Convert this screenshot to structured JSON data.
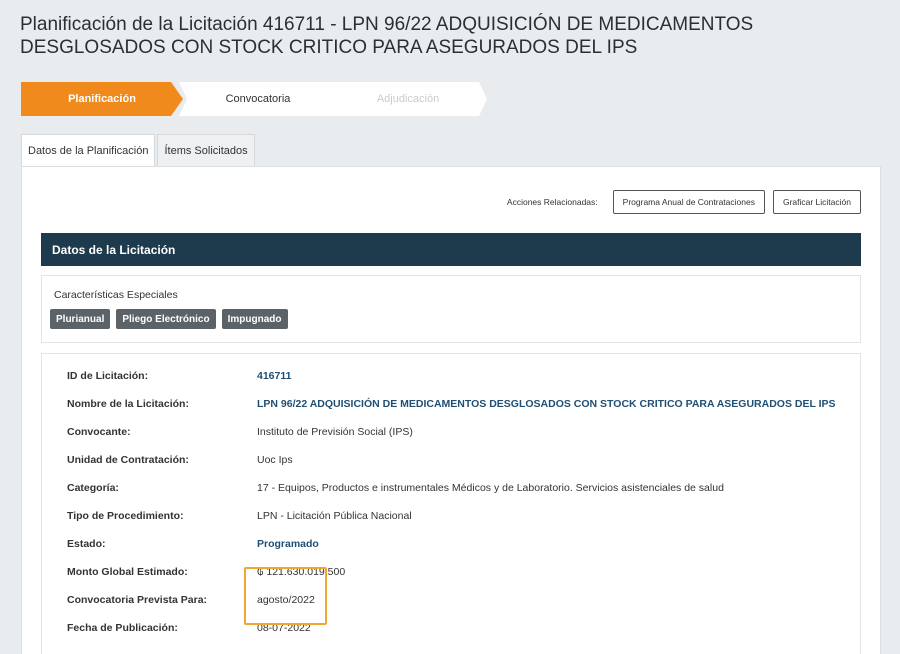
{
  "page": {
    "title": "Planificación de la Licitación 416711 - LPN 96/22 ADQUISICIÓN DE MEDICAMENTOS DESGLOSADOS CON STOCK CRITICO PARA ASEGURADOS DEL IPS"
  },
  "steps": [
    {
      "label": "Planificación",
      "state": "active"
    },
    {
      "label": "Convocatoria",
      "state": "enabled"
    },
    {
      "label": "Adjudicación",
      "state": "disabled"
    }
  ],
  "tabs": [
    {
      "label": "Datos de la Planificación",
      "active": true
    },
    {
      "label": "Ítems Solicitados",
      "active": false
    }
  ],
  "actions": {
    "label": "Acciones Relacionadas:",
    "buttons": [
      "Programa Anual de Contrataciones",
      "Graficar Licitación"
    ]
  },
  "section": {
    "header": "Datos de la Licitación"
  },
  "special": {
    "label": "Características Especiales",
    "badges": [
      "Plurianual",
      "Pliego Electrónico",
      "Impugnado"
    ]
  },
  "details": [
    {
      "label": "ID de Licitación:",
      "value": "416711",
      "style": "link"
    },
    {
      "label": "Nombre de la Licitación:",
      "value": "LPN 96/22 ADQUISICIÓN DE MEDICAMENTOS DESGLOSADOS CON STOCK CRITICO PARA ASEGURADOS DEL IPS",
      "style": "link"
    },
    {
      "label": "Convocante:",
      "value": "Instituto de Previsión Social (IPS)",
      "style": "plain"
    },
    {
      "label": "Unidad de Contratación:",
      "value": "Uoc Ips",
      "style": "plain"
    },
    {
      "label": "Categoría:",
      "value": "17 - Equipos, Productos e instrumentales Médicos y de Laboratorio. Servicios asistenciales de salud",
      "style": "plain"
    },
    {
      "label": "Tipo de Procedimiento:",
      "value": "LPN - Licitación Pública Nacional",
      "style": "plain"
    },
    {
      "label": "Estado:",
      "value": "Programado",
      "style": "status"
    },
    {
      "label": "Monto Global Estimado:",
      "value": "121.630.019.500",
      "currency": "₲",
      "style": "plain"
    },
    {
      "label": "Convocatoria Prevista Para:",
      "value": "agosto/2022",
      "style": "plain"
    },
    {
      "label": "Fecha de Publicación:",
      "value": "08-07-2022",
      "style": "plain"
    }
  ],
  "colors": {
    "accent": "#f08a1c",
    "header_bg": "#1d3b4c",
    "badge_bg": "#5b6268",
    "link": "#1f4f75",
    "highlight": "#f0a732"
  }
}
